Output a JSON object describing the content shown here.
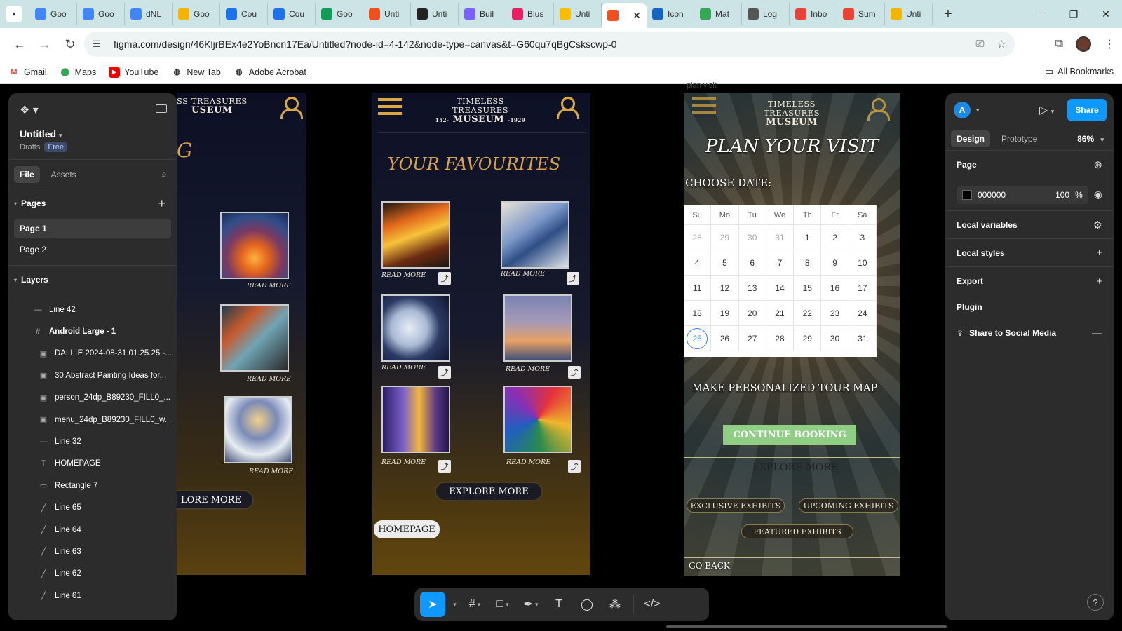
{
  "browser": {
    "tabs": [
      {
        "label": "Goo",
        "icon": "docs-icon",
        "color": "#4285f4"
      },
      {
        "label": "Goo",
        "icon": "docs-icon",
        "color": "#4285f4"
      },
      {
        "label": "dNL",
        "icon": "docs-icon",
        "color": "#4285f4"
      },
      {
        "label": "Goo",
        "icon": "slides-icon",
        "color": "#f4b400"
      },
      {
        "label": "Cou",
        "icon": "google-icon",
        "color": "#1a73e8"
      },
      {
        "label": "Cou",
        "icon": "google-icon",
        "color": "#1a73e8"
      },
      {
        "label": "Goo",
        "icon": "classroom-icon",
        "color": "#0f9d58"
      },
      {
        "label": "Unti",
        "icon": "figma-icon",
        "color": "#f24e1e"
      },
      {
        "label": "Unti",
        "icon": "play-icon",
        "color": "#222222"
      },
      {
        "label": "Buil",
        "icon": "site-icon",
        "color": "#7b61ff"
      },
      {
        "label": "Blus",
        "icon": "miro-icon",
        "color": "#e91e63"
      },
      {
        "label": "Unti",
        "icon": "site-icon",
        "color": "#fbbc04"
      },
      {
        "label": "",
        "icon": "figma-icon",
        "color": "#f24e1e",
        "active": true
      },
      {
        "label": "Icon",
        "icon": "site-icon",
        "color": "#1565c0"
      },
      {
        "label": "Mat",
        "icon": "site-icon",
        "color": "#34a853"
      },
      {
        "label": "Log",
        "icon": "site-icon",
        "color": "#555555"
      },
      {
        "label": "Inbo",
        "icon": "gmail-icon",
        "color": "#ea4335"
      },
      {
        "label": "Sum",
        "icon": "site-icon",
        "color": "#ea4335"
      },
      {
        "label": "Unti",
        "icon": "slides-icon",
        "color": "#f4b400"
      }
    ],
    "url": "figma.com/design/46KljrBEx4e2YoBncn17Ea/Untitled?node-id=4-142&node-type=canvas&t=G60qu7qBgCskscwp-0",
    "bookmarks": [
      "Gmail",
      "Maps",
      "YouTube",
      "New Tab",
      "Adobe Acrobat"
    ],
    "all_bookmarks": "All Bookmarks"
  },
  "left_panel": {
    "file_title": "Untitled",
    "drafts": "Drafts",
    "plan": "Free",
    "tab_file": "File",
    "tab_assets": "Assets",
    "pages_header": "Pages",
    "pages": [
      "Page 1",
      "Page 2"
    ],
    "layers_header": "Layers",
    "layers": [
      {
        "name": "Line 42",
        "icon": "—",
        "child": false,
        "bold": false
      },
      {
        "name": "Android Large - 1",
        "icon": "#",
        "child": false,
        "bold": true
      },
      {
        "name": "DALL·E 2024-08-31 01.25.25 -...",
        "icon": "▣",
        "child": true,
        "bold": false
      },
      {
        "name": "30 Abstract Painting Ideas for...",
        "icon": "▣",
        "child": true,
        "bold": false
      },
      {
        "name": "person_24dp_B89230_FILL0_...",
        "icon": "▣",
        "child": true,
        "bold": false
      },
      {
        "name": "menu_24dp_B89230_FILL0_w...",
        "icon": "▣",
        "child": true,
        "bold": false
      },
      {
        "name": "Line 32",
        "icon": "—",
        "child": true,
        "bold": false
      },
      {
        "name": "HOMEPAGE",
        "icon": "T",
        "child": true,
        "bold": false
      },
      {
        "name": "Rectangle 7",
        "icon": "▭",
        "child": true,
        "bold": false
      },
      {
        "name": "Line 65",
        "icon": "╱",
        "child": true,
        "bold": false
      },
      {
        "name": "Line 64",
        "icon": "╱",
        "child": true,
        "bold": false
      },
      {
        "name": "Line 63",
        "icon": "╱",
        "child": true,
        "bold": false
      },
      {
        "name": "Line 62",
        "icon": "╱",
        "child": true,
        "bold": false
      },
      {
        "name": "Line 61",
        "icon": "╱",
        "child": true,
        "bold": false
      }
    ]
  },
  "frame1": {
    "logo_line1": "SS TREASURES",
    "logo_line2": "USEUM",
    "title_fragment": "G",
    "read_more": "READ MORE",
    "explore": "LORE MORE"
  },
  "frame2": {
    "logo_line1": "TIMELESS TREASURES",
    "logo_line2": "MUSEUM",
    "logo_years_left": "152-",
    "logo_years_right": "-1929",
    "title": "YOUR FAVOURITES",
    "read_more": "READ MORE",
    "explore": "EXPLORE MORE",
    "homepage": "HOMEPAGE"
  },
  "frame3": {
    "label": "plan visit",
    "logo_line1": "TIMELESS TREASURES",
    "logo_line2": "MUSEUM",
    "title": "PLAN YOUR VISIT",
    "choose_date": "CHOOSE DATE:",
    "weekdays": [
      "Su",
      "Mo",
      "Tu",
      "We",
      "Th",
      "Fr",
      "Sa"
    ],
    "weeks": [
      [
        {
          "d": "28",
          "m": true
        },
        {
          "d": "29",
          "m": true
        },
        {
          "d": "30",
          "m": true
        },
        {
          "d": "31",
          "m": true
        },
        {
          "d": "1"
        },
        {
          "d": "2"
        },
        {
          "d": "3"
        }
      ],
      [
        {
          "d": "4"
        },
        {
          "d": "5"
        },
        {
          "d": "6"
        },
        {
          "d": "7"
        },
        {
          "d": "8"
        },
        {
          "d": "9"
        },
        {
          "d": "10"
        }
      ],
      [
        {
          "d": "11"
        },
        {
          "d": "12"
        },
        {
          "d": "13"
        },
        {
          "d": "14"
        },
        {
          "d": "15"
        },
        {
          "d": "16"
        },
        {
          "d": "17"
        }
      ],
      [
        {
          "d": "18"
        },
        {
          "d": "19"
        },
        {
          "d": "20"
        },
        {
          "d": "21"
        },
        {
          "d": "22"
        },
        {
          "d": "23"
        },
        {
          "d": "24"
        }
      ],
      [
        {
          "d": "25",
          "today": true
        },
        {
          "d": "26"
        },
        {
          "d": "27"
        },
        {
          "d": "28"
        },
        {
          "d": "29"
        },
        {
          "d": "30"
        },
        {
          "d": "31"
        }
      ]
    ],
    "tour_map": "MAKE PERSONALIZED TOUR MAP",
    "continue": "CONTINUE BOOKING",
    "explore": "EXPLORE MORE",
    "exclusive": "EXCLUSIVE EXHIBITS",
    "upcoming": "UPCOMING EXHIBITS",
    "featured": "FEATURED EXHIBITS",
    "go_back": "GO BACK"
  },
  "right_panel": {
    "avatar_letter": "A",
    "share": "Share",
    "tab_design": "Design",
    "tab_prototype": "Prototype",
    "zoom": "86%",
    "page_label": "Page",
    "fill_hex": "000000",
    "fill_opacity": "100",
    "percent": "%",
    "sections": [
      "Local variables",
      "Local styles",
      "Export"
    ],
    "plugin": "Plugin",
    "plugin_item": "Share to Social Media",
    "help": "?"
  },
  "colors": {
    "accent": "#0d99ff",
    "gold": "#d9a93f",
    "continue_green": "#8fce84",
    "panel_bg": "#2c2c2c"
  }
}
